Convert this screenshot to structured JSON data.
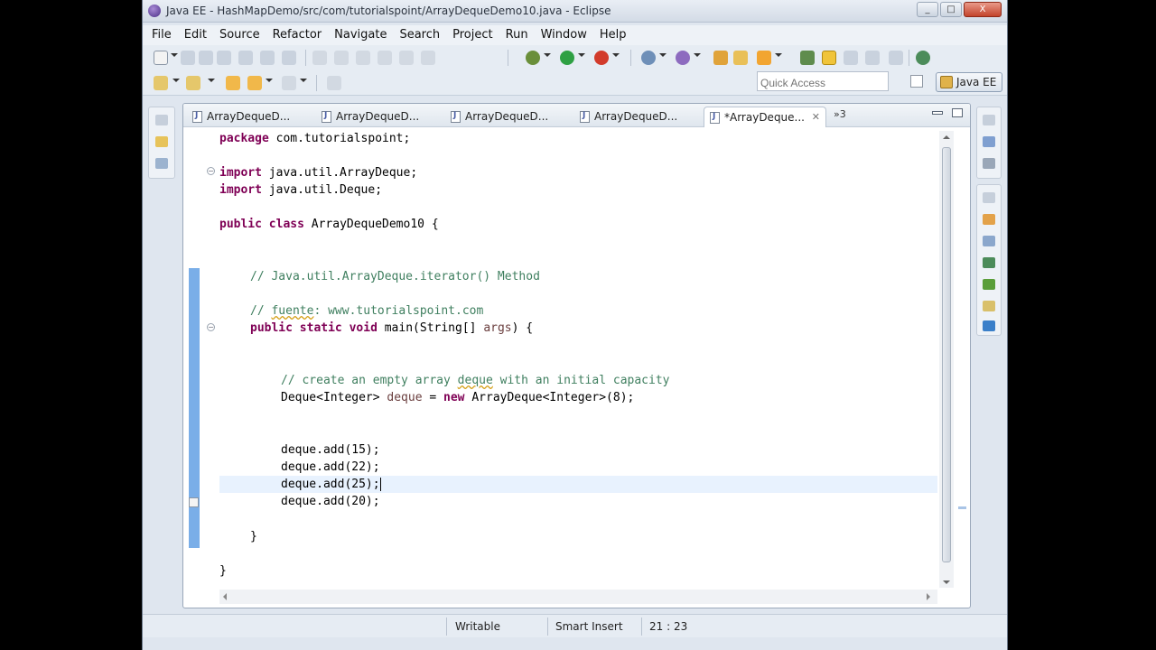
{
  "window": {
    "title": "Java EE - HashMapDemo/src/com/tutorialspoint/ArrayDequeDemo10.java - Eclipse",
    "controls": [
      "_",
      "□",
      "X"
    ]
  },
  "menu": [
    "File",
    "Edit",
    "Source",
    "Refactor",
    "Navigate",
    "Search",
    "Project",
    "Run",
    "Window",
    "Help"
  ],
  "toolbar": {
    "quick_access_placeholder": "Quick Access",
    "perspective": "Java EE"
  },
  "editor": {
    "tabs": [
      {
        "label": "ArrayDequeD...",
        "active": false
      },
      {
        "label": "ArrayDequeD...",
        "active": false
      },
      {
        "label": "ArrayDequeD...",
        "active": false
      },
      {
        "label": "ArrayDequeD...",
        "active": false
      },
      {
        "label": "*ArrayDeque...",
        "active": true
      }
    ],
    "tab_close": "✕",
    "overflow": "»3",
    "code": {
      "l1_kw": "package",
      "l1_rest": " com.tutorialspoint;",
      "l3_kw": "import",
      "l3_rest": " java.util.ArrayDeque;",
      "l4_kw": "import",
      "l4_rest": " java.util.Deque;",
      "l6_kw1": "public",
      "l6_kw2": "class",
      "l6_rest": " ArrayDequeDemo10 {",
      "l9_comment": "// Java.util.ArrayDeque.iterator() Method",
      "l11_comment_a": "// ",
      "l11_comment_b": "fuente",
      "l11_comment_c": ": www.tutorialspoint.com",
      "l12_kw1": "public",
      "l12_kw2": "static",
      "l12_kw3": "void",
      "l12_rest1": " main(String[] ",
      "l12_var": "args",
      "l12_rest2": ") {",
      "l15_comment_a": "// create an empty array ",
      "l15_comment_b": "deque",
      "l15_comment_c": " with an initial capacity",
      "l16_a": "Deque<Integer> ",
      "l16_var": "deque",
      "l16_b": " = ",
      "l16_kw": "new",
      "l16_c": " ArrayDeque<Integer>(8);",
      "l19": "deque.add(15);",
      "l20": "deque.add(22);",
      "l21": "deque.add(25);",
      "l22": "deque.add(20);",
      "l24": "}",
      "l26": "}"
    }
  },
  "status": {
    "writable": "Writable",
    "insert_mode": "Smart Insert",
    "position": "21 : 23"
  }
}
